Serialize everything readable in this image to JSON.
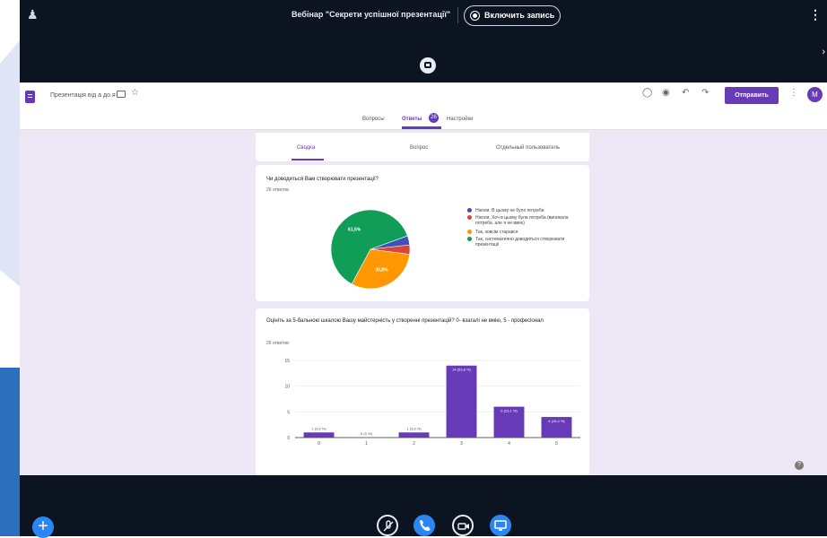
{
  "meeting": {
    "title": "Вебінар \"Секрети успішної презентації\"",
    "record_label": "Включить запись"
  },
  "form": {
    "doc_title": "Презентація від а до я",
    "send_label": "Отправить",
    "avatar_initial": "M",
    "tabs": {
      "questions": "Вопросы",
      "answers": "Ответы",
      "answers_count": "26",
      "settings": "Настройки"
    },
    "subtabs": {
      "summary": "Сводка",
      "question": "Вопрос",
      "individual": "Отдельный пользователь"
    }
  },
  "question1": {
    "title": "Чи доводиться Вам створювати презентації?",
    "responses": "26 ответов",
    "legend": [
      {
        "label": "Ніколи. В цьому не було потреби",
        "color": "#3f51b5"
      },
      {
        "label": "Ніколи. Хоч в цьому була потреба (виникала потреба, але я не вмію)",
        "color": "#db4437"
      },
      {
        "label": "Так, зовсім старався",
        "color": "#ff9800"
      },
      {
        "label": "Так, систематично доводиться створювати презентації",
        "color": "#0f9d58"
      }
    ]
  },
  "question2": {
    "title": "Оцініть за 5-бальною шкалою Вашу майстерність у створенні презентацій? 0- взагалі не вмію, 5 - професіонал",
    "responses": "26 ответов"
  },
  "chart_data": [
    {
      "type": "pie",
      "categories": [
        "Ніколи. В цьому не було потреби",
        "Ніколи. Хоч в цьому була потреба (виникала потреба, але я не вмію)",
        "Так, зовсім старався",
        "Так, систематично доводиться створювати презентації"
      ],
      "values": [
        3.8,
        3.8,
        30.8,
        61.5
      ],
      "data_labels": [
        "",
        "",
        "30,8%",
        "61,5%"
      ],
      "colors": [
        "#3f51b5",
        "#db4437",
        "#ff9800",
        "#0f9d58"
      ],
      "legend_position": "right"
    },
    {
      "type": "bar",
      "categories": [
        "0",
        "1",
        "2",
        "3",
        "4",
        "5"
      ],
      "values": [
        1,
        0,
        1,
        14,
        6,
        4
      ],
      "data_labels": [
        "1 (3,8 %)",
        "0 (0 %)",
        "1 (3,8 %)",
        "14 (53,8 %)",
        "6 (23,1 %)",
        "4 (15,4 %)"
      ],
      "yticks": [
        "0",
        "5",
        "10",
        "15"
      ],
      "ylim": [
        0,
        15
      ],
      "color": "#673ab7",
      "grid": true
    }
  ]
}
